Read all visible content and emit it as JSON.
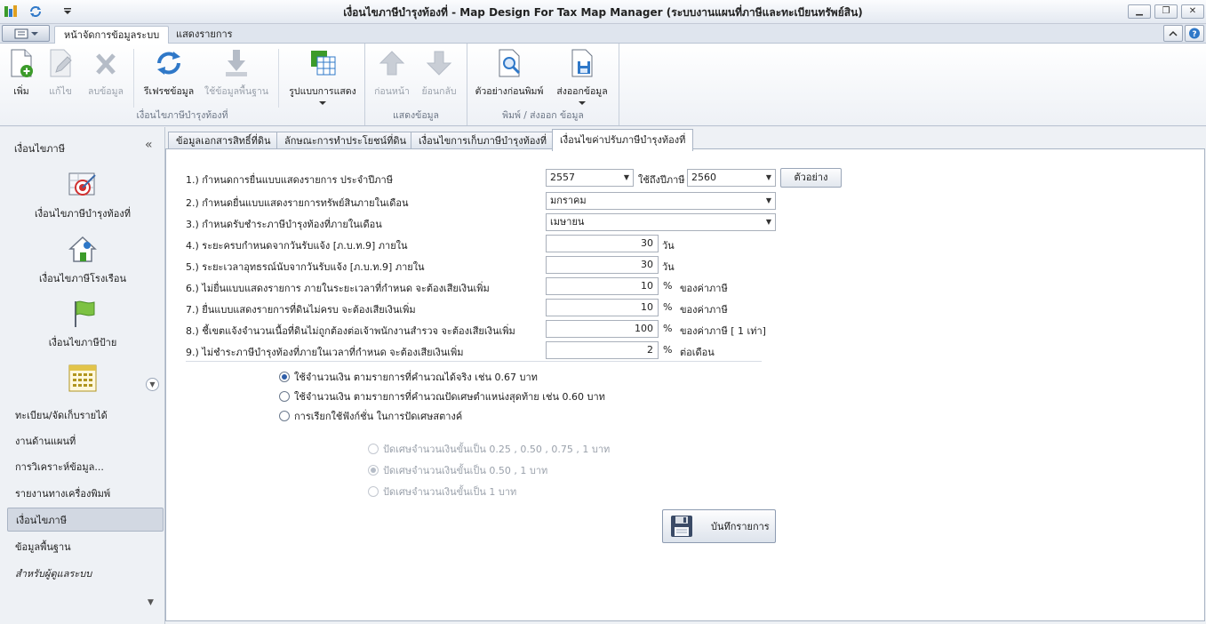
{
  "window": {
    "title": "เงื่อนไขภาษีบำรุงท้องที่ - Map Design For Tax Map Manager (ระบบงานแผนที่ภาษีและทะเบียนทรัพย์สิน)",
    "minimize": "▁",
    "restore": "❐",
    "close": "✕"
  },
  "ribbon_tabs": [
    {
      "label": "หน้าจัดการข้อมูลระบบ"
    },
    {
      "label": "แสดงรายการ"
    }
  ],
  "ribbon": {
    "groups": [
      {
        "label": "เงื่อนไขภาษีบำรุงท้องที่",
        "buttons": [
          {
            "label": "เพิ่ม"
          },
          {
            "label": "แก้ไข"
          },
          {
            "label": "ลบข้อมูล"
          },
          {
            "label": "รีเฟรชข้อมูล"
          },
          {
            "label": "ใช้ข้อมูลพื้นฐาน"
          },
          {
            "label": "รูปแบบการแสดง"
          }
        ]
      },
      {
        "label": "แสดงข้อมูล",
        "buttons": [
          {
            "label": "ก่อนหน้า"
          },
          {
            "label": "ย้อนกลับ"
          }
        ]
      },
      {
        "label": "พิมพ์ / ส่งออก ข้อมูล",
        "buttons": [
          {
            "label": "ตัวอย่างก่อนพิมพ์"
          },
          {
            "label": "ส่งออกข้อมูล"
          }
        ]
      }
    ]
  },
  "sidebar": {
    "header": "เงื่อนไขภาษี",
    "collapse": "«",
    "big_items": [
      {
        "label": "เงื่อนไขภาษีบำรุงท้องที่"
      },
      {
        "label": "เงื่อนไขภาษีโรงเรือน"
      },
      {
        "label": "เงื่อนไขภาษีป้าย"
      }
    ],
    "scroll": "▼",
    "items": [
      {
        "label": "ทะเบียน/จัดเก็บรายได้"
      },
      {
        "label": "งานด้านแผนที่"
      },
      {
        "label": "การวิเคราะห์ข้อมูล..."
      },
      {
        "label": "รายงานทางเครื่องพิมพ์"
      },
      {
        "label": "เงื่อนไขภาษี"
      },
      {
        "label": "ข้อมูลพื้นฐาน"
      },
      {
        "label": "สำหรับผู้ดูแลระบบ"
      }
    ],
    "footer": "▼"
  },
  "content_tabs": [
    {
      "label": "ข้อมูลเอกสารสิทธิ์ที่ดิน"
    },
    {
      "label": "ลักษณะการทำประโยชน์ที่ดิน"
    },
    {
      "label": "เงื่อนไขการเก็บภาษีบำรุงท้องที่"
    },
    {
      "label": "เงื่อนไขค่าปรับภาษีบำรุงท้องที่"
    }
  ],
  "form": {
    "rows": [
      {
        "label": "1.) กำหนดการยื่นแบบแสดงรายการ ประจำปีภาษี",
        "value": "2557",
        "mid_label": "ใช้ถึงปีภาษี",
        "value2": "2560",
        "button": "ตัวอย่าง"
      },
      {
        "label": "2.) กำหนดยื่นแบบแสดงรายการทรัพย์สินภายในเดือน",
        "value": "มกราคม"
      },
      {
        "label": "3.) กำหนดรับชำระภาษีบำรุงท้องที่ภายในเดือน",
        "value": "เมษายน"
      },
      {
        "label": "4.) ระยะครบกำหนดจากวันรับแจ้ง [ภ.บ.ท.9] ภายใน",
        "value": "30",
        "unit": "วัน"
      },
      {
        "label": "5.) ระยะเวลาอุทธรณ์นับจากวันรับแจ้ง [ภ.บ.ท.9] ภายใน",
        "value": "30",
        "unit": "วัน"
      },
      {
        "label": "6.) ไม่ยื่นแบบแสดงรายการ ภายในระยะเวลาที่กำหนด จะต้องเสียเงินเพิ่ม",
        "value": "10",
        "unit": "%",
        "suffix": "ของค่าภาษี"
      },
      {
        "label": "7.) ยื่นแบบแสดงรายการที่ดินไม่ครบ จะต้องเสียเงินเพิ่ม",
        "value": "10",
        "unit": "%",
        "suffix": "ของค่าภาษี"
      },
      {
        "label": "8.) ชี้เขตแจ้งจำนวนเนื้อที่ดินไม่ถูกต้องต่อเจ้าพนักงานสำรวจ จะต้องเสียเงินเพิ่ม",
        "value": "100",
        "unit": "%",
        "suffix": "ของค่าภาษี [ 1 เท่า]"
      },
      {
        "label": "9.) ไม่ชำระภาษีบำรุงท้องที่ภายในเวลาที่กำหนด จะต้องเสียเงินเพิ่ม",
        "value": "2",
        "unit": "%",
        "suffix": "ต่อเดือน"
      }
    ],
    "options": [
      {
        "label": "ใช้จำนวนเงิน ตามรายการที่คำนวณได้จริง  เช่น 0.67 บาท",
        "checked": true
      },
      {
        "label": "ใช้จำนวนเงิน ตามรายการที่คำนวณปัดเศษตำแหน่งสุดท้าย  เช่น 0.60 บาท",
        "checked": false
      },
      {
        "label": "การเรียกใช้ฟังก์ชั่น ในการปัดเศษสตางค์",
        "checked": false
      }
    ],
    "suboptions": [
      {
        "label": "ปัดเศษจำนวนเงินขั้นเป็น 0.25 , 0.50 , 0.75 , 1 บาท",
        "checked": false
      },
      {
        "label": "ปัดเศษจำนวนเงินขั้นเป็น 0.50 , 1 บาท",
        "checked": true
      },
      {
        "label": "ปัดเศษจำนวนเงินขั้นเป็น 1 บาท",
        "checked": false
      }
    ],
    "save_label": "บันทึกรายการ"
  },
  "colors": {
    "accent": "#2e5ea8",
    "icon_green": "#3c9b2a",
    "icon_blue": "#2f78c8",
    "disabled": "#9aa1ab"
  }
}
